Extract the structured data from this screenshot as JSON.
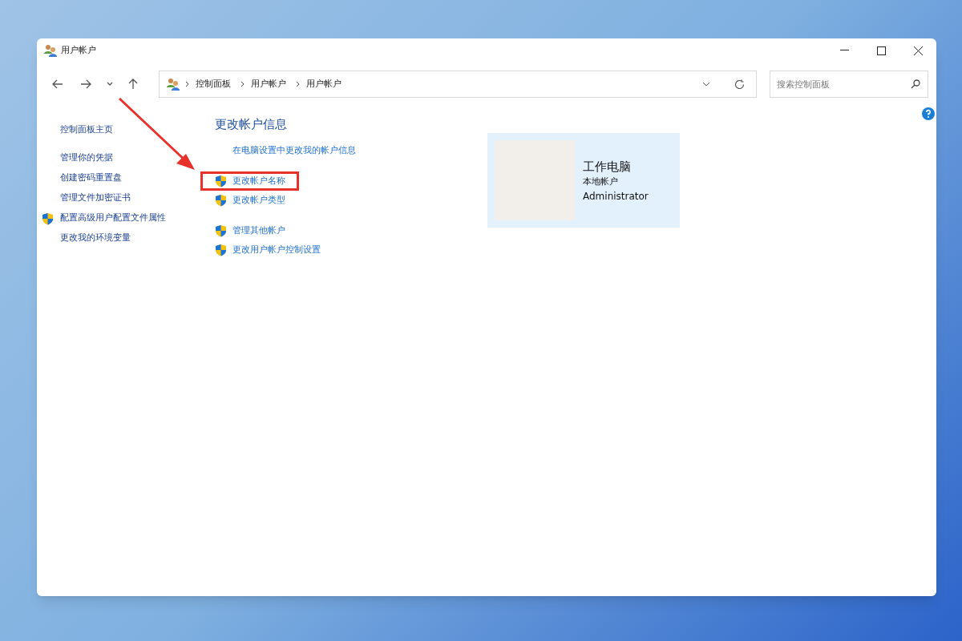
{
  "window": {
    "title": "用户帐户"
  },
  "address_bar": {
    "path": [
      "控制面板",
      "用户帐户",
      "用户帐户"
    ]
  },
  "search": {
    "placeholder": "搜索控制面板"
  },
  "sidebar": {
    "items": [
      {
        "label": "控制面板主页",
        "kind": "home",
        "shield": false
      },
      {
        "label": "管理你的凭据",
        "kind": "link",
        "shield": false
      },
      {
        "label": "创建密码重置盘",
        "kind": "link",
        "shield": false
      },
      {
        "label": "管理文件加密证书",
        "kind": "link",
        "shield": false
      },
      {
        "label": "配置高级用户配置文件属性",
        "kind": "link",
        "shield": true
      },
      {
        "label": "更改我的环境变量",
        "kind": "link",
        "shield": false
      }
    ]
  },
  "main": {
    "heading": "更改帐户信息",
    "link_groups": [
      [
        {
          "label": "在电脑设置中更改我的帐户信息",
          "shield": false,
          "highlighted": false
        }
      ],
      [
        {
          "label": "更改帐户名称",
          "shield": true,
          "highlighted": true
        },
        {
          "label": "更改帐户类型",
          "shield": true,
          "highlighted": false
        }
      ],
      [
        {
          "label": "管理其他帐户",
          "shield": true,
          "highlighted": false
        },
        {
          "label": "更改用户帐户控制设置",
          "shield": true,
          "highlighted": false
        }
      ]
    ]
  },
  "account": {
    "name": "工作电脑",
    "type": "本地帐户",
    "role": "Administrator"
  }
}
